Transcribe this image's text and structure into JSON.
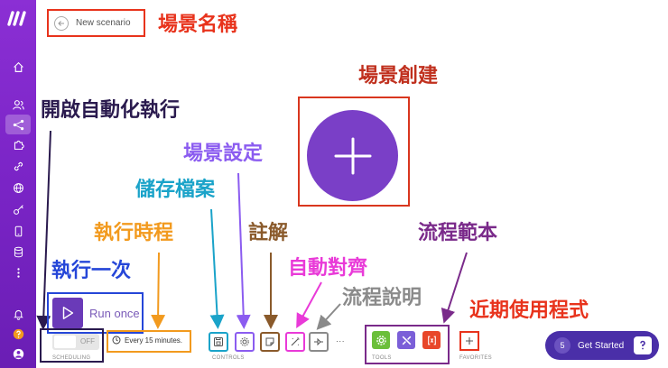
{
  "header": {
    "scenario_name": "New scenario"
  },
  "annotations": {
    "scenario_name": "場景名稱",
    "scenario_create": "場景創建",
    "enable_auto_run": "開啟自動化執行",
    "scenario_settings": "場景設定",
    "save_file": "儲存檔案",
    "run_schedule": "執行時程",
    "notes": "註解",
    "flow_template": "流程範本",
    "run_once": "執行一次",
    "auto_align": "自動對齊",
    "flow_explain": "流程說明",
    "recent_apps": "近期使用程式"
  },
  "run": {
    "label": "Run once"
  },
  "toolbar": {
    "toggle_state": "OFF",
    "scheduling_label": "SCHEDULING",
    "schedule_value": "Every 15 minutes.",
    "controls_label": "CONTROLS",
    "more_label": "···",
    "tools_label": "TOOLS",
    "favorites_label": "FAVORITES"
  },
  "get_started": {
    "count": "5",
    "label": "Get Started"
  },
  "colors": {
    "sidebar": "#7a24c6",
    "primary": "#7a3fc7",
    "annotation_red": "#e8331c",
    "annotation_darkred": "#c0301e",
    "annotation_navy": "#2a1a4e",
    "annotation_purple": "#8b5cf0",
    "annotation_cyan": "#1aa3c9",
    "annotation_orange": "#f29a1e",
    "annotation_brown": "#8a5a2b",
    "annotation_plum": "#7a2a8a",
    "annotation_blue": "#2546d8",
    "annotation_pink": "#e93ad8",
    "annotation_gray": "#8a8a8a"
  },
  "icons": {
    "sidebar": [
      "home-icon",
      "users-icon",
      "share-icon",
      "puzzle-icon",
      "link-icon",
      "globe-icon",
      "key-icon",
      "phone-icon",
      "database-icon",
      "more-vertical-icon",
      "bell-icon",
      "help-icon",
      "avatar-icon"
    ],
    "controls": [
      "save-icon",
      "settings-icon",
      "note-icon",
      "magic-wand-icon",
      "flow-explain-icon"
    ],
    "tools": [
      "tools-gear-icon",
      "flow-control-icon",
      "text-parser-icon"
    ]
  }
}
